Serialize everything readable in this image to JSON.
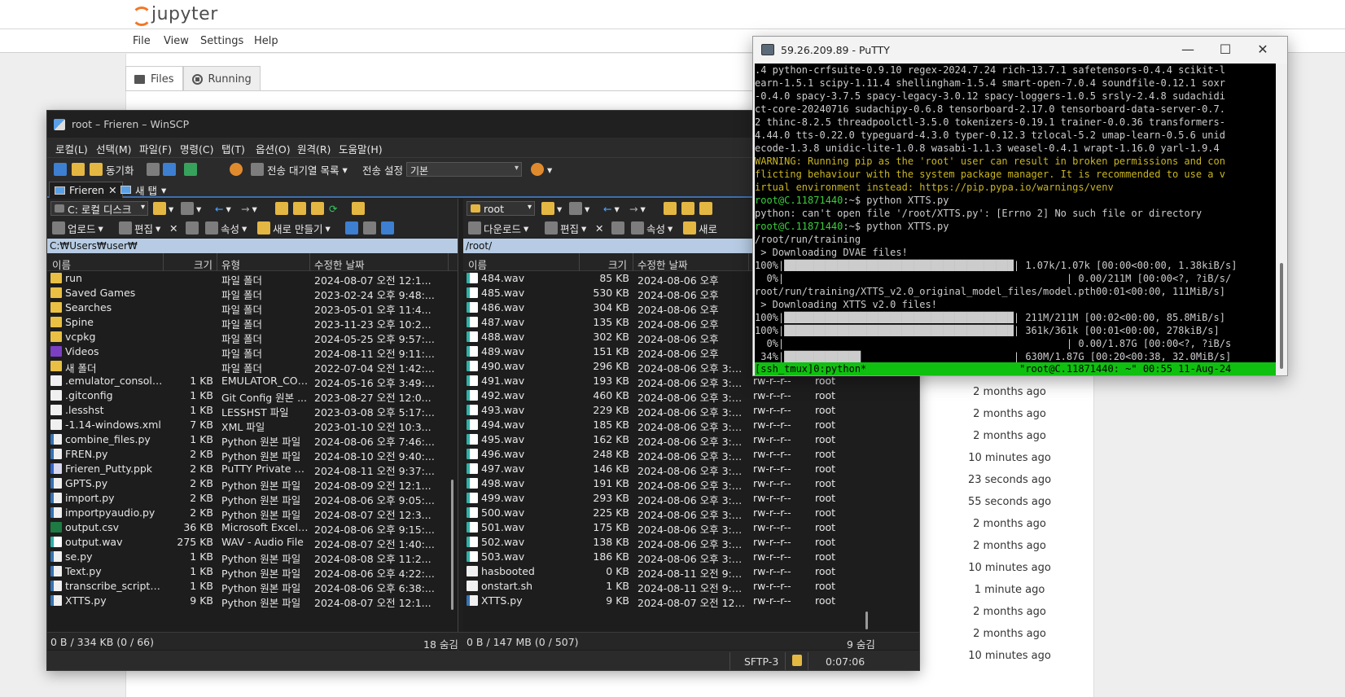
{
  "jupyter": {
    "brand": "jupyter",
    "menu": [
      "File",
      "View",
      "Settings",
      "Help"
    ],
    "tabs": [
      {
        "label": "Files"
      },
      {
        "label": "Running"
      }
    ],
    "times": [
      "2 months ago",
      "2 months ago",
      "2 months ago",
      "10 minutes ago",
      "23 seconds ago",
      "55 seconds ago",
      "2 months ago",
      "2 months ago",
      "10 minutes ago",
      "1 minute ago",
      "2 months ago",
      "2 months ago",
      "10 minutes ago"
    ]
  },
  "winscp": {
    "title": "root – Frieren – WinSCP",
    "menu": [
      "로컬(L)",
      "선택(M)",
      "파일(F)",
      "명령(C)",
      "탭(T)",
      "옵션(O)",
      "원격(R)",
      "도움말(H)"
    ],
    "toolbar": {
      "sync": "동기화",
      "queue": "전송 대기열 목록",
      "transfer_settings": "전송 설정",
      "transfer_preset": "기본"
    },
    "session_tabs": [
      {
        "label": "Frieren"
      },
      {
        "label": "새 탭"
      }
    ],
    "left": {
      "drive": "C: 로컬 디스크",
      "upload": "업로드",
      "edit": "편집",
      "props": "속성",
      "new": "새로 만들기",
      "path": "C:₩Users₩user₩",
      "headers": {
        "name": "이름",
        "size": "크기",
        "type": "유형",
        "modified": "수정한 날짜"
      },
      "rows": [
        {
          "icon": "folder",
          "name": "run",
          "size": "",
          "type": "파일 폴더",
          "date": "2024-08-07 오전 12:1..."
        },
        {
          "icon": "folder",
          "name": "Saved Games",
          "size": "",
          "type": "파일 폴더",
          "date": "2023-02-24 오후 9:48:..."
        },
        {
          "icon": "folder",
          "name": "Searches",
          "size": "",
          "type": "파일 폴더",
          "date": "2023-05-01 오후 11:4..."
        },
        {
          "icon": "folder",
          "name": "Spine",
          "size": "",
          "type": "파일 폴더",
          "date": "2023-11-23 오후 10:2..."
        },
        {
          "icon": "folder",
          "name": "vcpkg",
          "size": "",
          "type": "파일 폴더",
          "date": "2024-05-25 오후 9:57:..."
        },
        {
          "icon": "video",
          "name": "Videos",
          "size": "",
          "type": "파일 폴더",
          "date": "2024-08-11 오전 9:11:..."
        },
        {
          "icon": "folder",
          "name": "새 폴더",
          "size": "",
          "type": "파일 폴더",
          "date": "2022-07-04 오전 1:42:..."
        },
        {
          "icon": "file",
          "name": ".emulator_console_au...",
          "size": "1 KB",
          "type": "EMULATOR_CON...",
          "date": "2024-05-16 오후 3:49:..."
        },
        {
          "icon": "file",
          "name": ".gitconfig",
          "size": "1 KB",
          "type": "Git Config 원본 ...",
          "date": "2023-08-27 오전 12:0..."
        },
        {
          "icon": "file",
          "name": ".lesshst",
          "size": "1 KB",
          "type": "LESSHST 파일",
          "date": "2023-03-08 오후 5:17:..."
        },
        {
          "icon": "file",
          "name": "-1.14-windows.xml",
          "size": "7 KB",
          "type": "XML 파일",
          "date": "2023-01-10 오전 10:3..."
        },
        {
          "icon": "py",
          "name": "combine_files.py",
          "size": "1 KB",
          "type": "Python 원본 파일",
          "date": "2024-08-06 오후 7:46:..."
        },
        {
          "icon": "py",
          "name": "FREN.py",
          "size": "2 KB",
          "type": "Python 원본 파일",
          "date": "2024-08-10 오전 9:40:..."
        },
        {
          "icon": "key",
          "name": "Frieren_Putty.ppk",
          "size": "2 KB",
          "type": "PuTTY Private Key...",
          "date": "2024-08-11 오전 9:37:..."
        },
        {
          "icon": "py",
          "name": "GPTS.py",
          "size": "2 KB",
          "type": "Python 원본 파일",
          "date": "2024-08-09 오전 12:1..."
        },
        {
          "icon": "py",
          "name": "import.py",
          "size": "2 KB",
          "type": "Python 원본 파일",
          "date": "2024-08-06 오후 9:05:..."
        },
        {
          "icon": "py",
          "name": "importpyaudio.py",
          "size": "2 KB",
          "type": "Python 원본 파일",
          "date": "2024-08-07 오전 12:3..."
        },
        {
          "icon": "excel",
          "name": "output.csv",
          "size": "36 KB",
          "type": "Microsoft Excel ...",
          "date": "2024-08-06 오후 9:15:..."
        },
        {
          "icon": "wav",
          "name": "output.wav",
          "size": "275 KB",
          "type": "WAV - Audio File",
          "date": "2024-08-07 오전 1:40:..."
        },
        {
          "icon": "py",
          "name": "se.py",
          "size": "1 KB",
          "type": "Python 원본 파일",
          "date": "2024-08-08 오후 11:2..."
        },
        {
          "icon": "py",
          "name": "Text.py",
          "size": "1 KB",
          "type": "Python 원본 파일",
          "date": "2024-08-06 오후 4:22:..."
        },
        {
          "icon": "py",
          "name": "transcribe_script.py",
          "size": "1 KB",
          "type": "Python 원본 파일",
          "date": "2024-08-06 오후 6:38:..."
        },
        {
          "icon": "py",
          "name": "XTTS.py",
          "size": "9 KB",
          "type": "Python 원본 파일",
          "date": "2024-08-07 오전 12:1..."
        }
      ],
      "status_left": "0 B / 334 KB (0 / 66)",
      "status_right": "18 숨김"
    },
    "right": {
      "drive": "root",
      "download": "다운로드",
      "edit": "편집",
      "props": "속성",
      "new": "새로",
      "path": "/root/",
      "headers": {
        "name": "이름",
        "size": "크기",
        "modified": "수정한 날짜"
      },
      "rows": [
        {
          "icon": "wav",
          "name": "484.wav",
          "size": "85 KB",
          "date": "2024-08-06 오후",
          "rights": "",
          "owner": ""
        },
        {
          "icon": "wav",
          "name": "485.wav",
          "size": "530 KB",
          "date": "2024-08-06 오후",
          "rights": "",
          "owner": ""
        },
        {
          "icon": "wav",
          "name": "486.wav",
          "size": "304 KB",
          "date": "2024-08-06 오후",
          "rights": "",
          "owner": ""
        },
        {
          "icon": "wav",
          "name": "487.wav",
          "size": "135 KB",
          "date": "2024-08-06 오후",
          "rights": "",
          "owner": ""
        },
        {
          "icon": "wav",
          "name": "488.wav",
          "size": "302 KB",
          "date": "2024-08-06 오후",
          "rights": "",
          "owner": ""
        },
        {
          "icon": "wav",
          "name": "489.wav",
          "size": "151 KB",
          "date": "2024-08-06 오후",
          "rights": "",
          "owner": ""
        },
        {
          "icon": "wav",
          "name": "490.wav",
          "size": "296 KB",
          "date": "2024-08-06 오후 3:55:...",
          "rights": "rw-r--r--",
          "owner": "root"
        },
        {
          "icon": "wav",
          "name": "491.wav",
          "size": "193 KB",
          "date": "2024-08-06 오후 3:55:...",
          "rights": "rw-r--r--",
          "owner": "root"
        },
        {
          "icon": "wav",
          "name": "492.wav",
          "size": "460 KB",
          "date": "2024-08-06 오후 3:56:...",
          "rights": "rw-r--r--",
          "owner": "root"
        },
        {
          "icon": "wav",
          "name": "493.wav",
          "size": "229 KB",
          "date": "2024-08-06 오후 3:56:...",
          "rights": "rw-r--r--",
          "owner": "root"
        },
        {
          "icon": "wav",
          "name": "494.wav",
          "size": "185 KB",
          "date": "2024-08-06 오후 3:56:...",
          "rights": "rw-r--r--",
          "owner": "root"
        },
        {
          "icon": "wav",
          "name": "495.wav",
          "size": "162 KB",
          "date": "2024-08-06 오후 3:57:...",
          "rights": "rw-r--r--",
          "owner": "root"
        },
        {
          "icon": "wav",
          "name": "496.wav",
          "size": "248 KB",
          "date": "2024-08-06 오후 3:57:...",
          "rights": "rw-r--r--",
          "owner": "root"
        },
        {
          "icon": "wav",
          "name": "497.wav",
          "size": "146 KB",
          "date": "2024-08-06 오후 3:57:...",
          "rights": "rw-r--r--",
          "owner": "root"
        },
        {
          "icon": "wav",
          "name": "498.wav",
          "size": "191 KB",
          "date": "2024-08-06 오후 3:57:...",
          "rights": "rw-r--r--",
          "owner": "root"
        },
        {
          "icon": "wav",
          "name": "499.wav",
          "size": "293 KB",
          "date": "2024-08-06 오후 3:58:...",
          "rights": "rw-r--r--",
          "owner": "root"
        },
        {
          "icon": "wav",
          "name": "500.wav",
          "size": "225 KB",
          "date": "2024-08-06 오후 3:58:...",
          "rights": "rw-r--r--",
          "owner": "root"
        },
        {
          "icon": "wav",
          "name": "501.wav",
          "size": "175 KB",
          "date": "2024-08-06 오후 3:58:...",
          "rights": "rw-r--r--",
          "owner": "root"
        },
        {
          "icon": "wav",
          "name": "502.wav",
          "size": "138 KB",
          "date": "2024-08-06 오후 3:59:...",
          "rights": "rw-r--r--",
          "owner": "root"
        },
        {
          "icon": "wav",
          "name": "503.wav",
          "size": "186 KB",
          "date": "2024-08-06 오후 3:59:...",
          "rights": "rw-r--r--",
          "owner": "root"
        },
        {
          "icon": "file",
          "name": "hasbooted",
          "size": "0 KB",
          "date": "2024-08-11 오전 9:45:...",
          "rights": "rw-r--r--",
          "owner": "root"
        },
        {
          "icon": "file",
          "name": "onstart.sh",
          "size": "1 KB",
          "date": "2024-08-11 오전 9:45:...",
          "rights": "rw-r--r--",
          "owner": "root"
        },
        {
          "icon": "py",
          "name": "XTTS.py",
          "size": "9 KB",
          "date": "2024-08-07 오전 12:1...",
          "rights": "rw-r--r--",
          "owner": "root"
        }
      ],
      "status_left": "0 B / 147 MB (0 / 507)",
      "status_right": "9 숨김"
    },
    "bottom": {
      "protocol": "SFTP-3",
      "elapsed": "0:07:06"
    }
  },
  "putty": {
    "title": "59.26.209.89 - PuTTY",
    "lines": [
      {
        "t": ".4 python-crfsuite-0.9.10 regex-2024.7.24 rich-13.7.1 safetensors-0.4.4 scikit-l"
      },
      {
        "t": "earn-1.5.1 scipy-1.11.4 shellingham-1.5.4 smart-open-7.0.4 soundfile-0.12.1 soxr"
      },
      {
        "t": "-0.4.0 spacy-3.7.5 spacy-legacy-3.0.12 spacy-loggers-1.0.5 srsly-2.4.8 sudachidi"
      },
      {
        "t": "ct-core-20240716 sudachipy-0.6.8 tensorboard-2.17.0 tensorboard-data-server-0.7."
      },
      {
        "t": "2 thinc-8.2.5 threadpoolctl-3.5.0 tokenizers-0.19.1 trainer-0.0.36 transformers-"
      },
      {
        "t": "4.44.0 tts-0.22.0 typeguard-4.3.0 typer-0.12.3 tzlocal-5.2 umap-learn-0.5.6 unid"
      },
      {
        "t": "ecode-1.3.8 unidic-lite-1.0.8 wasabi-1.1.3 weasel-0.4.1 wrapt-1.16.0 yarl-1.9.4"
      },
      {
        "t": "WARNING: Running pip as the 'root' user can result in broken permissions and con",
        "cls": "warn"
      },
      {
        "t": "flicting behaviour with the system package manager. It is recommended to use a v",
        "cls": "warn"
      },
      {
        "t": "irtual environment instead: https://pip.pypa.io/warnings/venv",
        "cls": "warn"
      },
      {
        "p": "root@C.11871440",
        "t": ":~$ python XTTS.py"
      },
      {
        "t": "python: can't open file '/root/XTTS.py': [Errno 2] No such file or directory"
      },
      {
        "p": "root@C.11871440",
        "t": ":~$ python XTTS.py"
      },
      {
        "t": "/root/run/training"
      },
      {
        "t": " > Downloading DVAE files!"
      },
      {
        "t": "100%|███████████████████████████████████████| 1.07k/1.07k [00:00<00:00, 1.38kiB/s]"
      },
      {
        "t": "  0%|                                                | 0.00/211M [00:00<?, ?iB/s/"
      },
      {
        "t": "root/run/training/XTTS_v2.0_original_model_files/model.pth00:01<00:00, 111MiB/s]"
      },
      {
        "t": " > Downloading XTTS v2.0 files!"
      },
      {
        "t": "100%|███████████████████████████████████████| 211M/211M [00:02<00:00, 85.8MiB/s]"
      },
      {
        "t": "100%|███████████████████████████████████████| 361k/361k [00:01<00:00, 278kiB/s]"
      },
      {
        "t": "  0%|                                                | 0.00/1.87G [00:00<?, ?iB/s"
      },
      {
        "t": " 34%|█████████████                          | 630M/1.87G [00:20<00:38, 32.0MiB/s]"
      }
    ],
    "tmux_status": "[ssh_tmux]0:python*                          \"root@C.11871440: ~\" 00:55 11-Aug-24"
  }
}
